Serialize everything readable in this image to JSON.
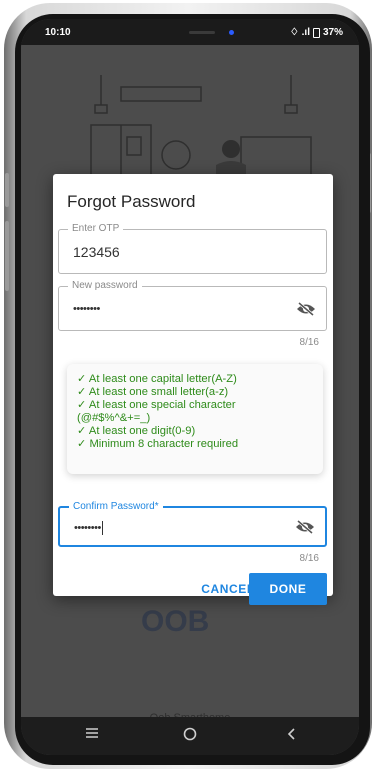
{
  "status_bar": {
    "time": "10:10",
    "signal_text": "♢ .ıl",
    "battery_text": "37%"
  },
  "background": {
    "logo_text": "OOB",
    "caption": "Oob Smarthome"
  },
  "dialog": {
    "title": "Forgot Password",
    "otp": {
      "label": "Enter OTP",
      "value": "123456"
    },
    "new_password": {
      "label": "New password",
      "value": "••••••••",
      "counter": "8/16",
      "toggle_icon": "eye-off-icon"
    },
    "rules": [
      "✓ At least one capital letter(A-Z)",
      "✓ At least one small letter(a-z)",
      "✓ At least one special character",
      "(@#$%^&+=_)",
      "✓ At least one digit(0-9)",
      "✓ Minimum 8 character required"
    ],
    "confirm_password": {
      "label": "Confirm Password*",
      "value": "••••••••",
      "counter": "8/16",
      "toggle_icon": "eye-off-icon"
    },
    "cancel_label": "CANCEL",
    "done_label": "DONE"
  },
  "nav_bar": {
    "menu_icon": "menu-icon",
    "home_icon": "home-icon",
    "back_icon": "back-icon"
  },
  "colors": {
    "accent": "#1f86e0",
    "rule_green": "#2e8b1a"
  }
}
